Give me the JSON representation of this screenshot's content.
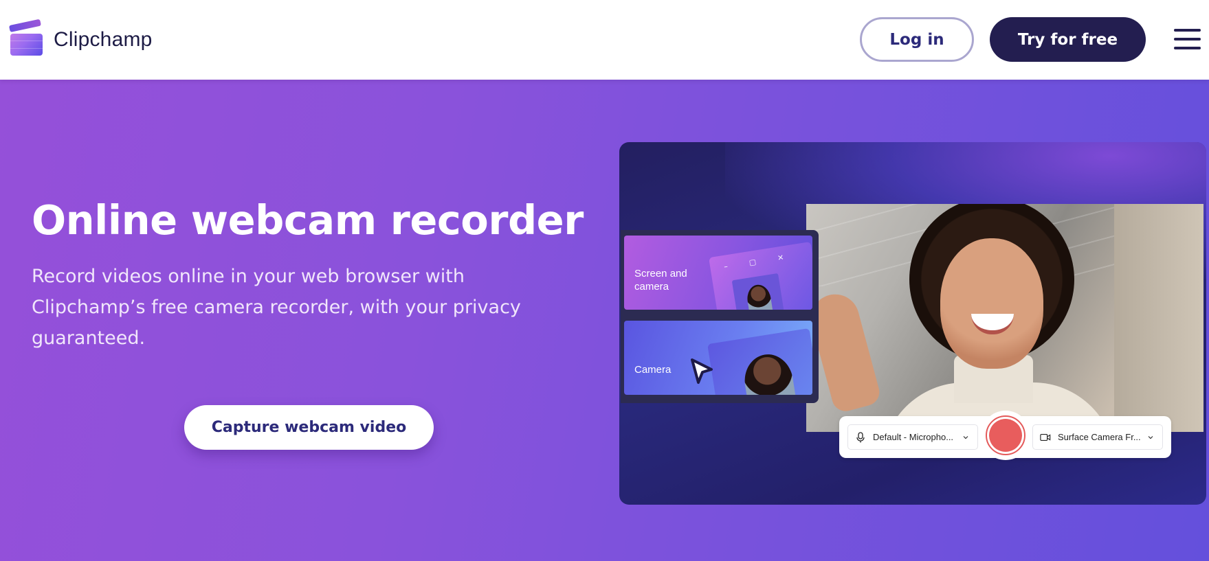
{
  "nav": {
    "brand": "Clipchamp",
    "login_label": "Log in",
    "try_label": "Try for free",
    "menu_icon": "hamburger-menu-icon"
  },
  "hero": {
    "title": "Online webcam recorder",
    "subtitle": "Record videos online in your web browser with Clipchamp’s free camera recorder, with your privacy guaranteed.",
    "cta_label": "Capture webcam video"
  },
  "preview": {
    "modes": [
      {
        "label": "Screen and camera",
        "window_controls": "– ▢ ✕"
      },
      {
        "label": "Camera"
      }
    ],
    "microphone_select": {
      "value": "Default - Micropho...",
      "icon": "microphone-icon"
    },
    "camera_select": {
      "value": "Surface Camera Fr...",
      "icon": "video-camera-icon"
    },
    "record_button": {
      "icon": "record-icon"
    }
  },
  "colors": {
    "brand_dark": "#231e50",
    "hero_gradient_start": "#9550d9",
    "hero_gradient_end": "#6450dc",
    "record_red": "#e85d5d"
  }
}
